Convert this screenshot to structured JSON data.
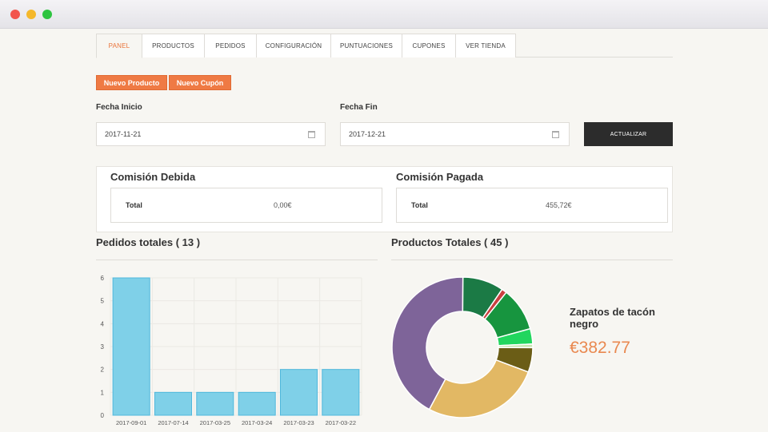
{
  "tabs": [
    "PANEL",
    "PRODUCTOS",
    "PEDIDOS",
    "CONFIGURACIÓN",
    "PUNTUACIONES",
    "CUPONES",
    "VER TIENDA"
  ],
  "active_tab": "PANEL",
  "actions": {
    "new_product": "Nuevo Producto",
    "new_coupon": "Nuevo Cupón"
  },
  "filters": {
    "start_label": "Fecha Inicio",
    "start_value": "2017-11-21",
    "end_label": "Fecha Fin",
    "end_value": "2017-12-21",
    "update_button": "ACTUALIZAR"
  },
  "commission": {
    "due_title": "Comisión Debida",
    "due_key": "Total",
    "due_value": "0,00€",
    "paid_title": "Comisión Pagada",
    "paid_key": "Total",
    "paid_value": "455,72€"
  },
  "orders_title": "Pedidos totales ( 13 )",
  "products_title": "Productos Totales ( 45 )",
  "featured_product": {
    "name": "Zapatos de tacón negro",
    "price": "€382.77"
  },
  "colors": {
    "accent_orange": "#ef7a44",
    "bar_fill": "#7fd0e8",
    "bar_stroke": "#4fb8dc"
  },
  "chart_data": [
    {
      "type": "bar",
      "categories": [
        "2017-09-01",
        "2017-07-14",
        "2017-03-25",
        "2017-03-24",
        "2017-03-23",
        "2017-03-22"
      ],
      "values": [
        6,
        1,
        1,
        1,
        2,
        2
      ],
      "yticks": [
        0,
        1,
        2,
        3,
        4,
        5,
        6
      ],
      "ylim": [
        0,
        6
      ],
      "grid": true
    },
    {
      "type": "pie",
      "donut": true,
      "slices": [
        {
          "value": 36,
          "color": "#7e6499"
        },
        {
          "value": 8,
          "color": "#1b7a45"
        },
        {
          "value": 1,
          "color": "#c94040"
        },
        {
          "value": 8.5,
          "color": "#17953f"
        },
        {
          "value": 3,
          "color": "#22d65e"
        },
        {
          "value": 0.7,
          "color": "#c8e6b0"
        },
        {
          "value": 4.8,
          "color": "#6b5d16"
        },
        {
          "value": 23,
          "color": "#e2b864"
        }
      ]
    }
  ]
}
